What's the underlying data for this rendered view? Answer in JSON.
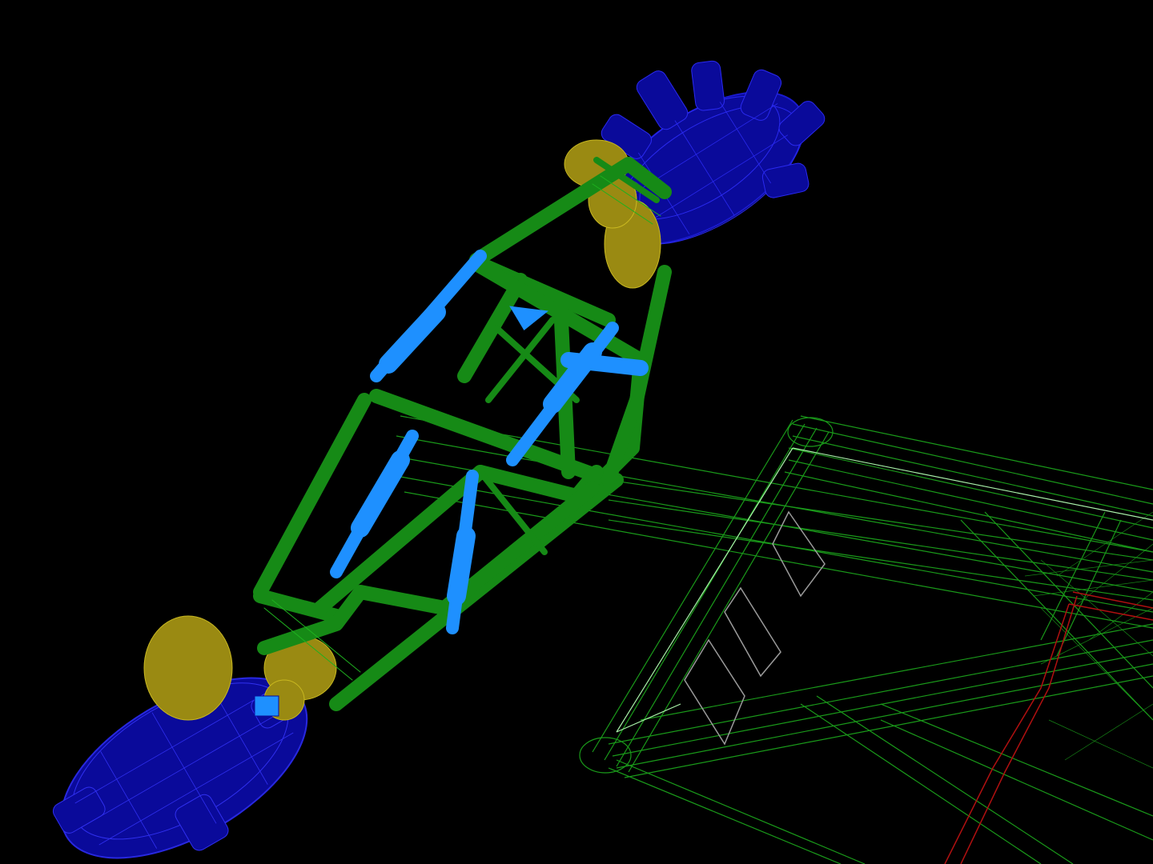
{
  "scene": {
    "background": "#000000",
    "colors": {
      "upper_flange": "#0a0a9a",
      "upper_flange_line": "#1a1ad0",
      "lower_flange": "#0a0a9a",
      "lower_flange_line": "#2828e0",
      "joint": "#9a8a12",
      "joint_line": "#c9b820",
      "platform_frame": "#168a16",
      "actuators": "#1e90ff",
      "base_wireframe": "#1a9a1a",
      "base_highlight": "#a8f0a8",
      "mount_plates": "#9a9a9a",
      "red_frame": "#b01010"
    },
    "parts": {
      "upper_flange": "gear-flange",
      "lower_flange": "gear-flange",
      "platform_frame": "hexapod-frame",
      "actuators": "linear-actuators",
      "base": "support-truss",
      "joints": "universal-joints"
    }
  }
}
